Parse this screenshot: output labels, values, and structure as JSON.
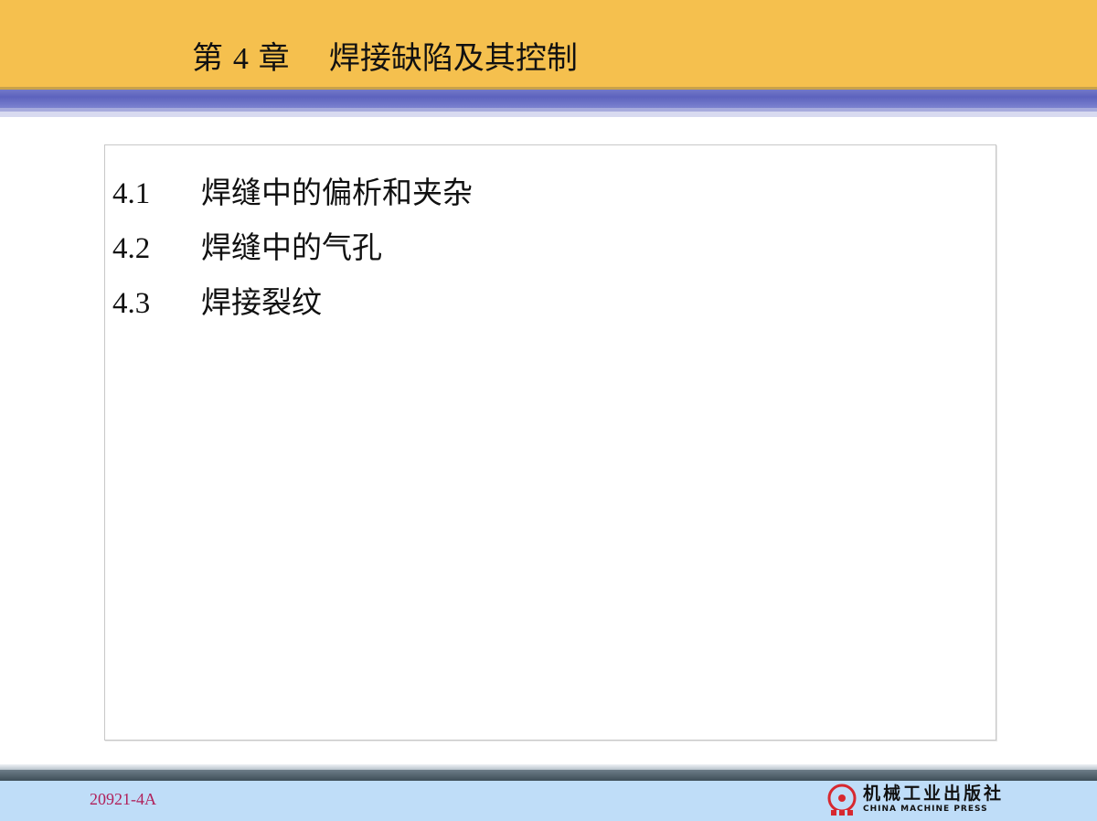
{
  "header": {
    "chapter_prefix": "第",
    "chapter_number": "4",
    "chapter_suffix": "章",
    "chapter_title": "焊接缺陷及其控制"
  },
  "toc": [
    {
      "number": "4.1",
      "title": "焊缝中的偏析和夹杂"
    },
    {
      "number": "4.2",
      "title": "焊缝中的气孔"
    },
    {
      "number": "4.3",
      "title": "焊接裂纹"
    }
  ],
  "footer": {
    "code": "20921-4A",
    "publisher_cn": "机械工业出版社",
    "publisher_en": "CHINA MACHINE PRESS"
  },
  "colors": {
    "header_bg": "#F5C04E",
    "stripe": "#5D63BE",
    "footer_bg": "#BFDDF8",
    "code_text": "#B0205A",
    "logo_red": "#D7282F"
  }
}
